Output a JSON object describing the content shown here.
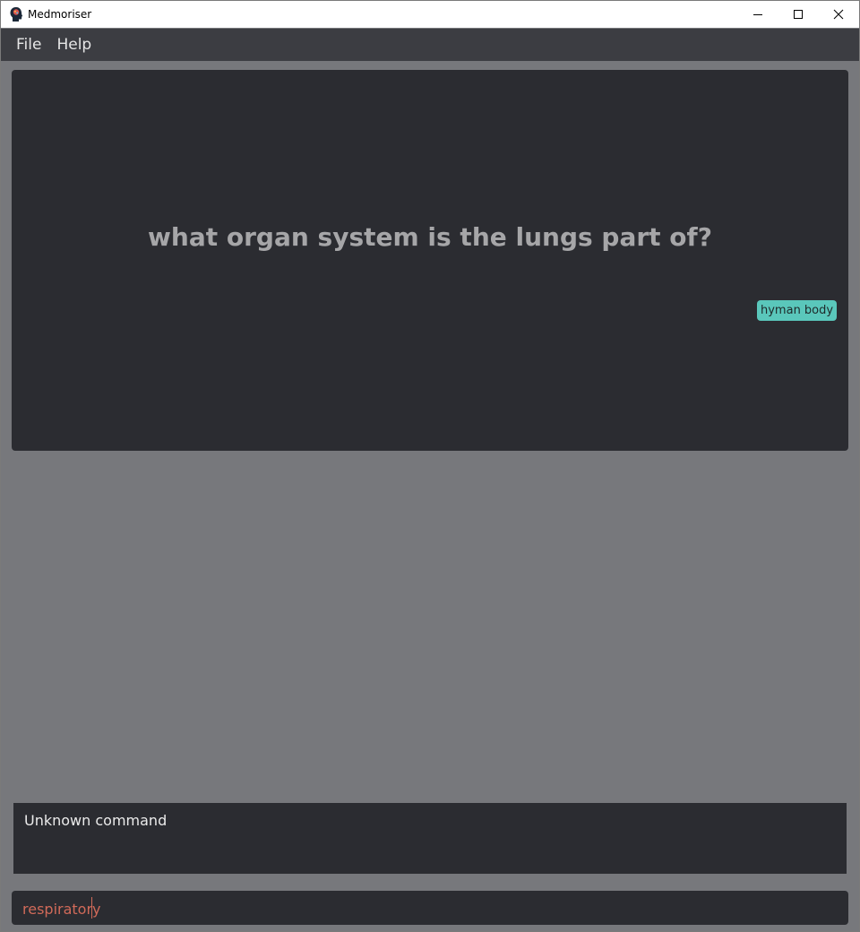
{
  "window": {
    "title": "Medmoriser",
    "icon": "brain-head-icon",
    "controls": [
      "minimize-icon",
      "maximize-icon",
      "close-icon"
    ]
  },
  "menu": {
    "items": [
      {
        "label": "File"
      },
      {
        "label": "Help"
      }
    ]
  },
  "flashcard": {
    "question": "what organ system is the lungs part of?",
    "tag": "hyman body"
  },
  "result": {
    "message": "Unknown command"
  },
  "command": {
    "value": "respiratory"
  },
  "colors": {
    "background": "#77787c",
    "panel": "#2b2c31",
    "menubar": "#3c3d42",
    "tag": "#5ac7bb",
    "command_text": "#d16a59"
  }
}
